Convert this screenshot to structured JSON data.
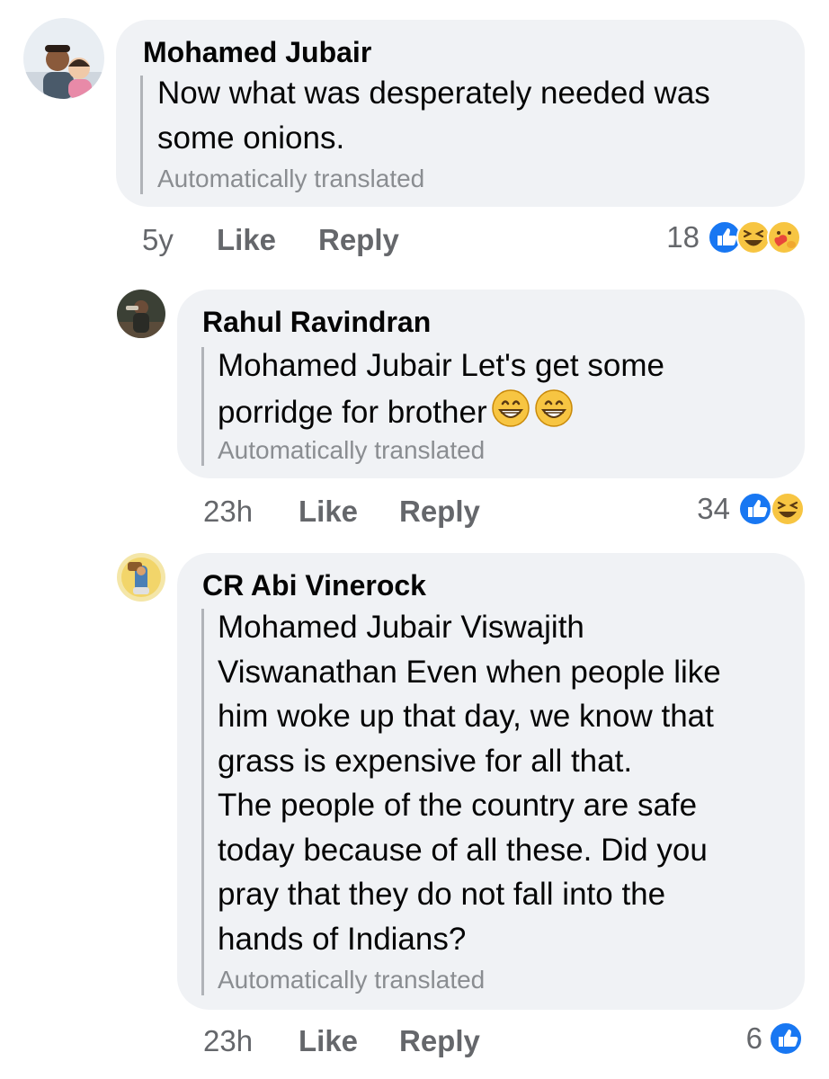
{
  "comments": [
    {
      "author": "Mohamed Jubair",
      "text_lines": [
        "Now what was desperately needed was",
        "some onions."
      ],
      "translated_label": "Automatically translated",
      "time": "5y",
      "like_label": "Like",
      "reply_label": "Reply",
      "reaction_count": "18",
      "reactions": [
        "like-icon",
        "laugh-icon",
        "care-icon"
      ]
    },
    {
      "author": "Rahul Ravindran",
      "text_lines": [
        "Mohamed Jubair Let's get some",
        "porridge for brother"
      ],
      "trailing_emoji": [
        "grinning-face-icon",
        "grinning-face-icon"
      ],
      "translated_label": "Automatically translated",
      "time": "23h",
      "like_label": "Like",
      "reply_label": "Reply",
      "reaction_count": "34",
      "reactions": [
        "like-icon",
        "laugh-icon"
      ]
    },
    {
      "author": "CR Abi Vinerock",
      "text_lines": [
        "Mohamed Jubair Viswajith",
        "Viswanathan Even when people like",
        "him woke up that day, we know that",
        "grass is expensive for all that.",
        "The people of the country are safe",
        "today because of all these. Did you",
        "pray that they do not fall into the",
        "hands of Indians?"
      ],
      "translated_label": "Automatically translated",
      "time": "23h",
      "like_label": "Like",
      "reply_label": "Reply",
      "reaction_count": "6",
      "reactions": [
        "like-icon"
      ]
    }
  ],
  "colors": {
    "bubble": "#f0f2f5",
    "like_blue": "#1877f2",
    "emoji_yellow": "#f7c542",
    "muted_text": "#65676b"
  }
}
